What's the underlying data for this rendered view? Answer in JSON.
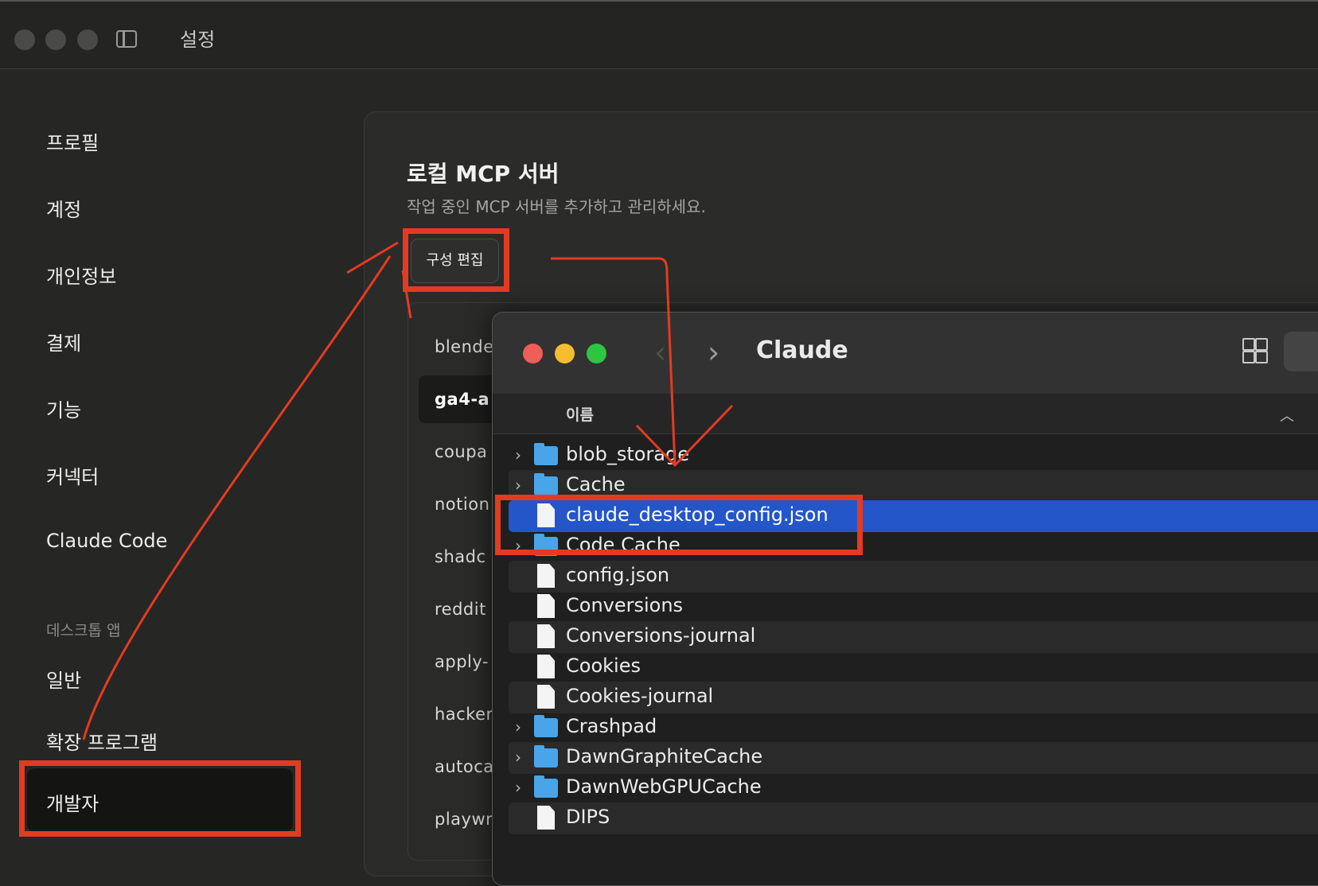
{
  "window": {
    "title": "설정"
  },
  "sidebar": {
    "items": [
      {
        "label": "프로필"
      },
      {
        "label": "계정"
      },
      {
        "label": "개인정보"
      },
      {
        "label": "결제"
      },
      {
        "label": "기능"
      },
      {
        "label": "커넥터"
      },
      {
        "label": "Claude Code"
      }
    ],
    "section_label": "데스크톱 앱",
    "desktop_items": [
      {
        "label": "일반"
      },
      {
        "label": "확장 프로그램"
      },
      {
        "label": "개발자",
        "active": true
      }
    ]
  },
  "main": {
    "title": "로컬 MCP 서버",
    "subtitle": "작업 중인 MCP 서버를 추가하고 관리하세요.",
    "edit_config_button": "구성 편집",
    "servers": [
      "blende",
      "ga4-a",
      "coupa",
      "notion",
      "shadc",
      "reddit",
      "apply-",
      "hacker",
      "autoca",
      "playwr"
    ],
    "active_server_index": 1
  },
  "finder": {
    "title": "Claude",
    "column_name": "이름",
    "rows": [
      {
        "name": "blob_storage",
        "type": "folder"
      },
      {
        "name": "Cache",
        "type": "folder"
      },
      {
        "name": "claude_desktop_config.json",
        "type": "file",
        "selected": true
      },
      {
        "name": "Code Cache",
        "type": "folder"
      },
      {
        "name": "config.json",
        "type": "file"
      },
      {
        "name": "Conversions",
        "type": "file"
      },
      {
        "name": "Conversions-journal",
        "type": "file"
      },
      {
        "name": "Cookies",
        "type": "file"
      },
      {
        "name": "Cookies-journal",
        "type": "file"
      },
      {
        "name": "Crashpad",
        "type": "folder"
      },
      {
        "name": "DawnGraphiteCache",
        "type": "folder"
      },
      {
        "name": "DawnWebGPUCache",
        "type": "folder"
      },
      {
        "name": "DIPS",
        "type": "file"
      }
    ]
  },
  "colors": {
    "annotation_red": "#e33b22",
    "selection_blue": "#2456c9",
    "folder_blue": "#4aa4e8"
  }
}
